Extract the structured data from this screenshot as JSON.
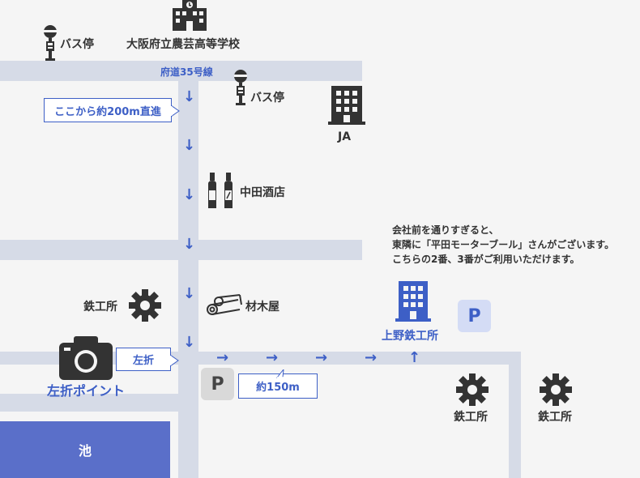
{
  "landmarks": {
    "school": "大阪府立農芸高等学校",
    "bus_stop_1": "バス停",
    "bus_stop_2": "バス停",
    "ja": "JA",
    "sake_shop": "中田酒店",
    "ironworks_left": "鉄工所",
    "lumber": "材木屋",
    "uenotekko": "上野鉄工所",
    "ironworks_b1": "鉄工所",
    "ironworks_b2": "鉄工所",
    "pond": "池"
  },
  "roads": {
    "route35": "府道35号線"
  },
  "callouts": {
    "straight": "ここから約200m直進",
    "turn_left": "左折",
    "distance": "約150m"
  },
  "photo_point": "左折ポイント",
  "parking": {
    "p1": "P",
    "p2": "P"
  },
  "note": {
    "line1": "会社前を通りすぎると、",
    "line2": "東隣に「平田モーターブール」さんがございます。",
    "line3": "こちらの2番、3番がご利用いただけます。"
  },
  "arrows": {
    "down": "↓",
    "right": "→",
    "up": "↑"
  },
  "colors": {
    "road": "#d6dbe7",
    "accent": "#3d5fc6",
    "pond": "#5a6fc9",
    "parking_blue_bg": "#d4dcf5",
    "parking_gray_bg": "#d9d9d9"
  }
}
